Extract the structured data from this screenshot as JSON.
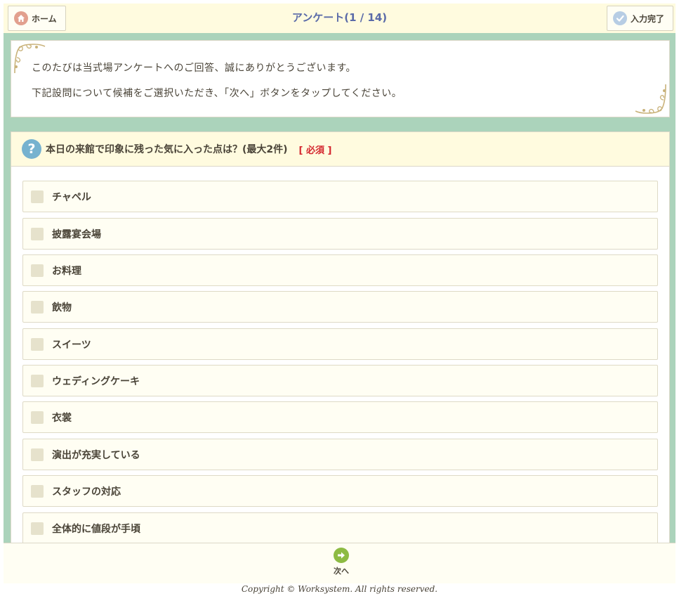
{
  "header": {
    "home_label": "ホーム",
    "title": "アンケート(1 / 14)",
    "done_label": "入力完了"
  },
  "intro": {
    "line1": "このたびは当式場アンケートへのご回答、誠にありがとうございます。",
    "line2": "下記設問について候補をご選択いただき、「次へ」ボタンをタップしてください。"
  },
  "question": {
    "text": "本日の来館で印象に残った気に入った点は？(最大2件)",
    "required": "[ 必須 ]",
    "options": [
      "チャペル",
      "披露宴会場",
      "お料理",
      "飲物",
      "スイーツ",
      "ウェディングケーキ",
      "衣裳",
      "演出が充実している",
      "スタッフの対応",
      "全体的に値段が手頃"
    ]
  },
  "footer": {
    "next_label": "次へ",
    "copyright": "Copyright © Worksystem. All rights reserved."
  },
  "colors": {
    "frame": "#abd3bb",
    "header_bg": "#fffbdf",
    "title": "#5a6aa8",
    "required": "#d4262e",
    "next_icon": "#8dbb43"
  },
  "icons": {
    "home": "home-icon",
    "done": "check-icon",
    "question": "question-icon",
    "next": "arrow-right-icon"
  }
}
